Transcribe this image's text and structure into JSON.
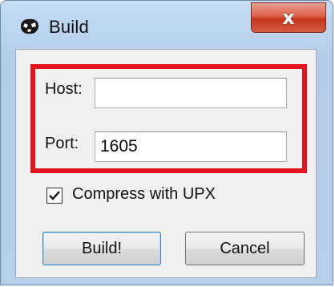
{
  "window": {
    "title": "Build",
    "close_glyph": "x"
  },
  "form": {
    "host_label": "Host:",
    "host_value": "",
    "port_label": "Port:",
    "port_value": "1605"
  },
  "options": {
    "compress_label": "Compress with UPX",
    "compress_checked": true
  },
  "buttons": {
    "build_label": "Build!",
    "cancel_label": "Cancel"
  },
  "colors": {
    "highlight": "#e3141f",
    "close_button": "#c4391f"
  }
}
